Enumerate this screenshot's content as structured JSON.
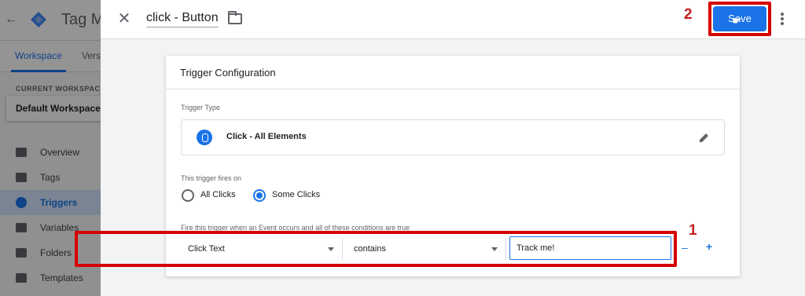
{
  "app": {
    "title": "Tag Ma",
    "tabs": [
      "Workspace",
      "Vers"
    ],
    "workspace_heading": "CURRENT WORKSPACE",
    "workspace_name": "Default Workspace",
    "nav": [
      {
        "label": "Overview",
        "icon": "overview-icon"
      },
      {
        "label": "Tags",
        "icon": "tag-icon"
      },
      {
        "label": "Triggers",
        "icon": "trigger-icon",
        "active": true
      },
      {
        "label": "Variables",
        "icon": "variables-icon"
      },
      {
        "label": "Folders",
        "icon": "folder-icon"
      },
      {
        "label": "Templates",
        "icon": "templates-icon"
      }
    ]
  },
  "dialog": {
    "close_glyph": "✕",
    "trigger_name": "click - Button",
    "save_label": "Save",
    "annotation_save": "2",
    "card_title": "Trigger Configuration",
    "trigger_type_label": "Trigger Type",
    "trigger_type_name": "Click - All Elements",
    "fires_on_label": "This trigger fires on",
    "radio_all": "All Clicks",
    "radio_some": "Some Clicks",
    "selected_radio": "Some Clicks",
    "conditions_label": "Fire this trigger when an Event occurs and all of these conditions are true",
    "annotation_conditions": "1",
    "condition": {
      "variable": "Click Text",
      "operator": "contains",
      "value": "Track me!"
    },
    "remove_glyph": "–",
    "add_glyph": "+"
  },
  "colors": {
    "accent": "#1a73e8",
    "annotation_red": "#d50000"
  }
}
